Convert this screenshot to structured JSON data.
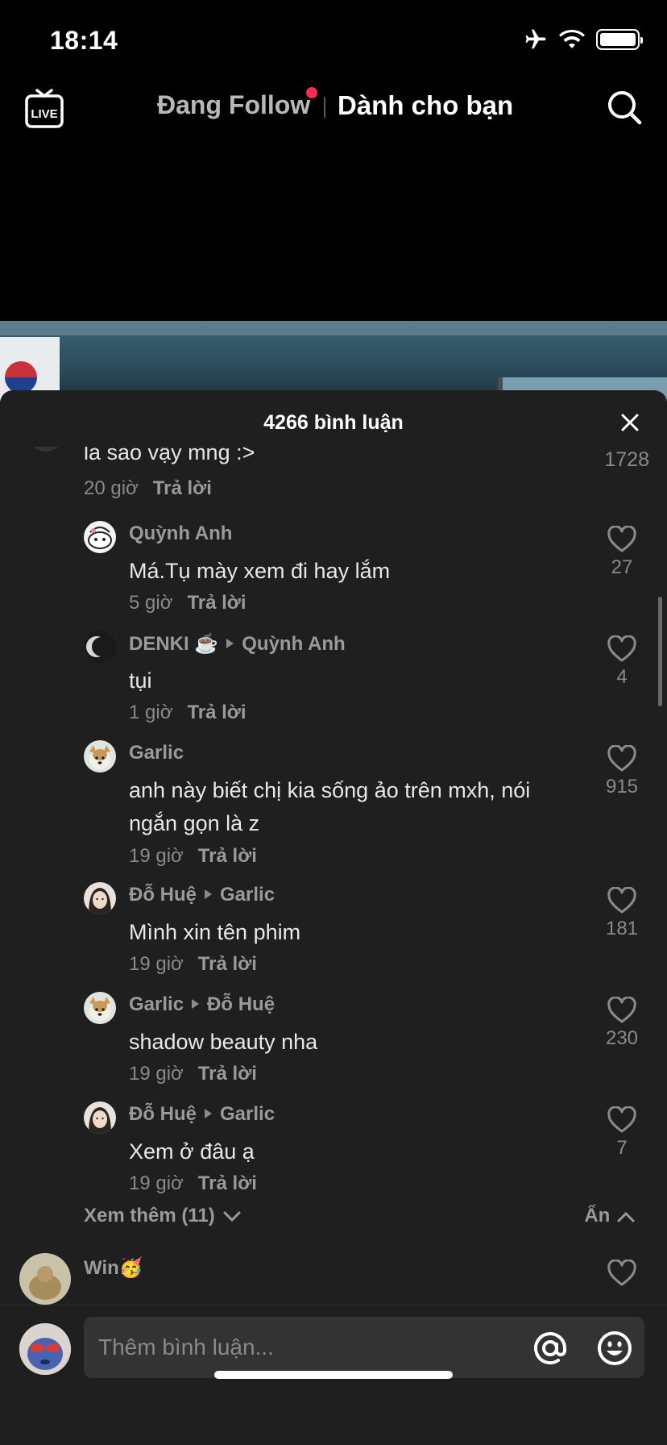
{
  "status_bar": {
    "time": "18:14"
  },
  "top_nav": {
    "live_label": "LIVE",
    "tab_following": "Đang Follow",
    "tab_for_you": "Dành cho bạn"
  },
  "sheet": {
    "title": "4266 bình luận",
    "partial_comment": {
      "text": "là sao vậy mng :>",
      "time": "20 giờ",
      "reply_label": "Trả lời",
      "likes": "1728"
    },
    "replies": [
      {
        "name": "Quỳnh Anh",
        "reply_to": "",
        "text": "Má.Tụ mày xem đi hay lắm",
        "time": "5 giờ",
        "reply_label": "Trả lời",
        "likes": "27"
      },
      {
        "name": "DENKI ☕",
        "reply_to": "Quỳnh Anh",
        "text": "tụi",
        "time": "1 giờ",
        "reply_label": "Trả lời",
        "likes": "4"
      },
      {
        "name": "Garlic",
        "reply_to": "",
        "text": "anh này biết chị kia sống ảo trên mxh, nói ngắn gọn là z",
        "time": "19 giờ",
        "reply_label": "Trả lời",
        "likes": "915"
      },
      {
        "name": "Đỗ Huệ",
        "reply_to": "Garlic",
        "text": "Mình xin tên phim",
        "time": "19 giờ",
        "reply_label": "Trả lời",
        "likes": "181"
      },
      {
        "name": "Garlic",
        "reply_to": "Đỗ Huệ",
        "text": "shadow beauty nha",
        "time": "19 giờ",
        "reply_label": "Trả lời",
        "likes": "230"
      },
      {
        "name": "Đỗ Huệ",
        "reply_to": "Garlic",
        "text": "Xem ở đâu ạ",
        "time": "19 giờ",
        "reply_label": "Trả lời",
        "likes": "7"
      }
    ],
    "view_more": "Xem thêm (11)",
    "hide": "Ẩn",
    "next_comment": {
      "name": "Win🥳"
    }
  },
  "input": {
    "placeholder": "Thêm bình luận..."
  }
}
